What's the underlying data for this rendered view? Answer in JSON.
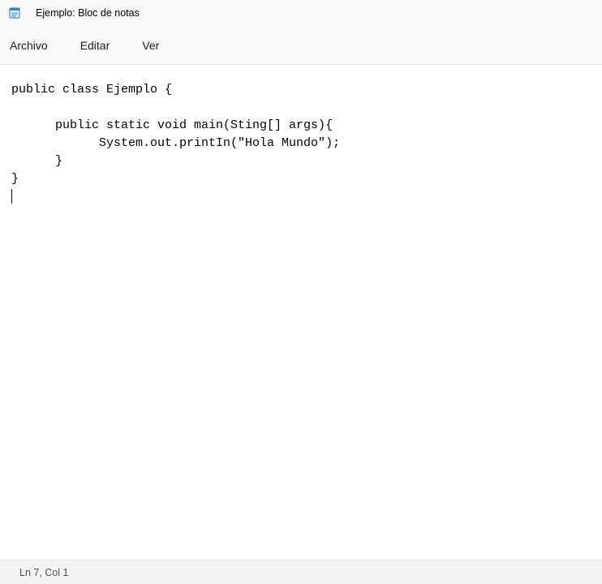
{
  "title_bar": {
    "title": "Ejemplo: Bloc de notas"
  },
  "menu": {
    "file": "Archivo",
    "edit": "Editar",
    "view": "Ver"
  },
  "editor": {
    "content": "public class Ejemplo {\n\n      public static void main(Sting[] args){\n            System.out.printIn(\"Hola Mundo\");\n      }\n}"
  },
  "status": {
    "position": "Ln 7, Col 1"
  }
}
